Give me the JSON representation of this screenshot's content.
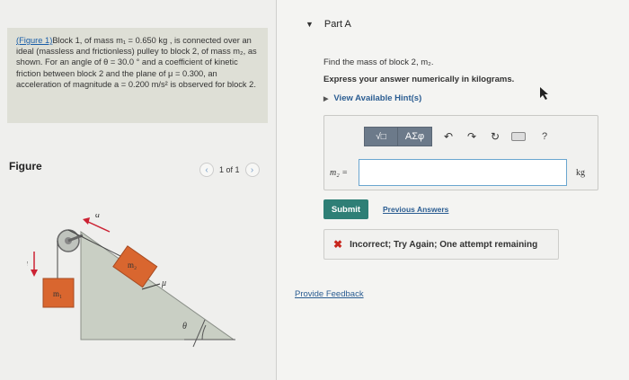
{
  "problem": {
    "link": "(Figure 1)",
    "text": "Block 1, of mass m₁ = 0.650 kg , is connected over an ideal (massless and frictionless) pulley to block 2, of mass m₂, as shown. For an angle of θ = 30.0 ° and a coefficient of kinetic friction between block 2 and the plane of μ = 0.300, an acceleration of magnitude a = 0.200 m/s² is observed for block 2."
  },
  "figure": {
    "label": "Figure",
    "pager": "1 of 1",
    "labels": {
      "accel_top": "a⃗",
      "accel_left": "a⃗",
      "block2": "m₂",
      "block1": "m₁",
      "mu": "μ",
      "theta": "θ"
    }
  },
  "part": {
    "title": "Part A"
  },
  "question": {
    "text": "Find the mass of block 2, m₂.",
    "instruction": "Express your answer numerically in kilograms.",
    "hint": "View Available Hint(s)"
  },
  "toolbar": {
    "sqrt": "√□",
    "greek": "AΣφ",
    "undo": "↶",
    "redo": "↷",
    "reset": "↻",
    "help": "?"
  },
  "answer": {
    "variable": "m₂ =",
    "value": "",
    "unit": "kg"
  },
  "buttons": {
    "submit": "Submit",
    "previous": "Previous Answers"
  },
  "feedback": {
    "icon": "✖",
    "message": "Incorrect; Try Again; One attempt remaining"
  },
  "provide_feedback": "Provide Feedback",
  "colors": {
    "submit": "#2e7f76",
    "error": "#c8261c",
    "link": "#2b5d92",
    "problem_bg": "#dedfd6"
  }
}
